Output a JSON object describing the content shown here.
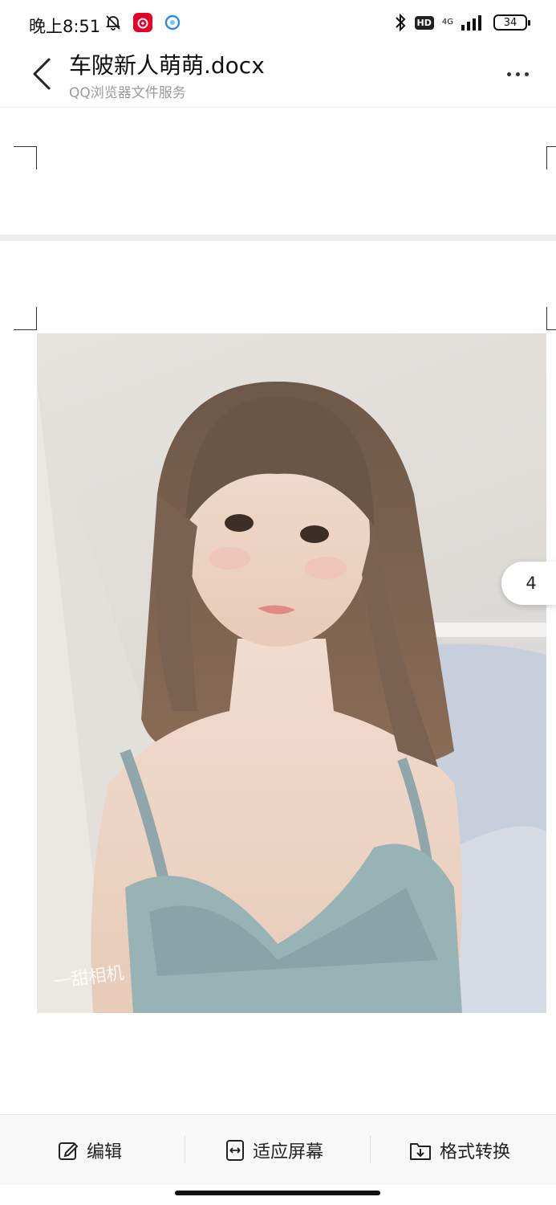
{
  "status_bar": {
    "time": "晚上8:51",
    "network_type": "4G",
    "hd_label": "HD",
    "battery_level": "34"
  },
  "header": {
    "title": "车陂新人萌萌.docx",
    "subtitle": "QQ浏览器文件服务"
  },
  "viewer": {
    "page_indicator": "4",
    "image_watermark": "一甜相机"
  },
  "toolbar": {
    "edit_label": "编辑",
    "fit_label": "适应屏幕",
    "convert_label": "格式转换"
  },
  "colors": {
    "background": "#ffffff",
    "toolbar_bg": "#f8f8f8",
    "subtitle": "#9a9a9a",
    "text": "#222222"
  },
  "icons": [
    "mute-bell-icon",
    "netease-music-icon",
    "qq-browser-icon",
    "bluetooth-icon",
    "signal-icon",
    "back-icon",
    "more-icon",
    "edit-icon",
    "fit-screen-icon",
    "format-convert-icon"
  ]
}
